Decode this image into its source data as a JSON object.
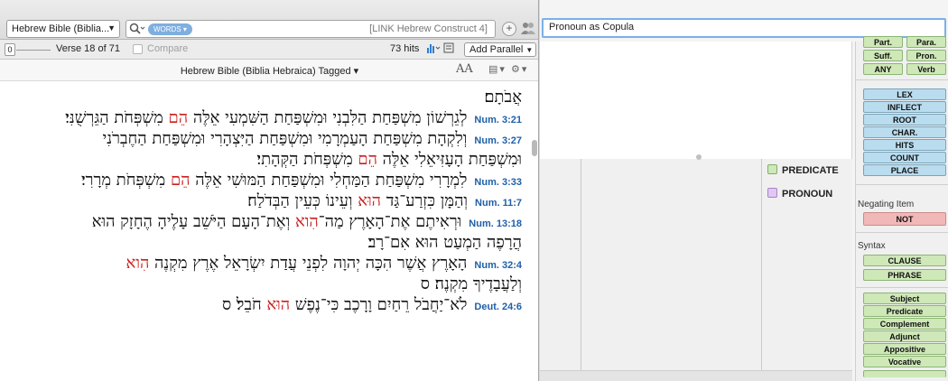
{
  "left_pane": {
    "version_select": "Hebrew Bible (Biblia...",
    "search_mode_pill": "WORDS",
    "search_text": "[LINK Hebrew Construct 4]",
    "slider_value": "0",
    "verse_position": "Verse 18 of 71",
    "compare_label": "Compare",
    "hits": "73 hits",
    "add_parallel": "Add Parallel",
    "results_title": "Hebrew Bible (Biblia Hebraica) Tagged",
    "font_size_label": "AA",
    "results": [
      {
        "ref": "",
        "pre": "אֲבֹתָם׃",
        "hl": "",
        "post": ""
      },
      {
        "ref": "Num. 3:21",
        "pre": "לְגֵרְשׁוֹן מִשְׁפַּחַת הַלִּבְנִי וּמִשְׁפַּחַת הַשִּׁמְעִי אֵלֶּה ",
        "hl": "הֵם",
        "post": " מִשְׁפְּחֹת הַגֵּרְשֻׁנִּי׃"
      },
      {
        "ref": "Num. 3:27",
        "pre": "וְלִקְהָת מִשְׁפַּחַת הָעַמְרָמִי וּמִשְׁפַּחַת הַיִּצְהָרִי וּמִשְׁפַּחַת הַחֶבְרֹנִי",
        "hl": "",
        "post": ""
      },
      {
        "ref": "",
        "pre": "וּמִשְׁפַּחַת הָעָזִּיאֵלִי אֵלֶּה ",
        "hl": "הֵם",
        "post": " מִשְׁפְּחֹת הַקְּהָתִי׃"
      },
      {
        "ref": "Num. 3:33",
        "pre": "לִמְרָרִי מִשְׁפַּחַת הַמַּחְלִי וּמִשְׁפַּחַת הַמּוּשִׁי אֵלֶּה ",
        "hl": "הֵם",
        "post": " מִשְׁפְּחֹת מְרָרִי׃"
      },
      {
        "ref": "Num. 11:7",
        "pre": "וְהַמָּן כִּזְרַע־גַּד ",
        "hl": "הוּא",
        "post": " וְעֵינוֹ כְּעֵין הַבְּדֹלַח׃"
      },
      {
        "ref": "Num. 13:18",
        "pre": "וּרְאִיתֶם אֶת־הָאָרֶץ מַה־",
        "hl": "הִוא",
        "post": " וְאֶת־הָעָם הַיֹּשֵׁב עָלֶיהָ הֶחָזָק הוּא"
      },
      {
        "ref": "",
        "pre": "הֲרָפֶה הַמְעַט הוּא אִם־רָב׃",
        "hl": "",
        "post": ""
      },
      {
        "ref": "Num. 32:4",
        "pre": "הָאָרֶץ אֲשֶׁר הִכָּה יְהוָה לִפְנֵי עֲדַת יִשְׂרָאֵל אֶרֶץ מִקְנֶה ",
        "hl": "הִוא",
        "post": ""
      },
      {
        "ref": "",
        "pre": "וְלַעֲבָדֶיךָ מִקְנֶה׃ ס",
        "hl": "",
        "post": ""
      },
      {
        "ref": "Deut. 24:6",
        "pre": "לֹא־יַחֲבֹל רֵחַיִם וָרָכֶב כִּי־נֶפֶשׁ ",
        "hl": "הוּא",
        "post": " חֹבֵל׃ ס"
      }
    ]
  },
  "right_pane": {
    "query_title": "Pronoun as Copula",
    "legend": [
      {
        "label": "PREDICATE",
        "color": "#cfe8b8"
      },
      {
        "label": "PRONOUN",
        "color": "#e0c8f2"
      }
    ],
    "palette": {
      "cut_row": [
        "Part.",
        "Para."
      ],
      "row1": [
        "Suff.",
        "Pron."
      ],
      "row2": [
        "ANY",
        "Verb"
      ],
      "attribute_buttons": [
        "LEX",
        "INFLECT",
        "ROOT",
        "CHAR.",
        "HITS",
        "COUNT",
        "PLACE"
      ],
      "negating_label": "Negating Item",
      "negating_button": "NOT",
      "syntax_label": "Syntax",
      "syntax_buttons": [
        "CLAUSE",
        "PHRASE"
      ],
      "role_buttons": [
        "Subject",
        "Predicate",
        "Complement",
        "Adjunct",
        "Appositive",
        "Vocative"
      ]
    }
  },
  "colors": {
    "highlight": "#c8201e",
    "reference": "#1f5fa8",
    "query_border": "#7bb0e8"
  }
}
